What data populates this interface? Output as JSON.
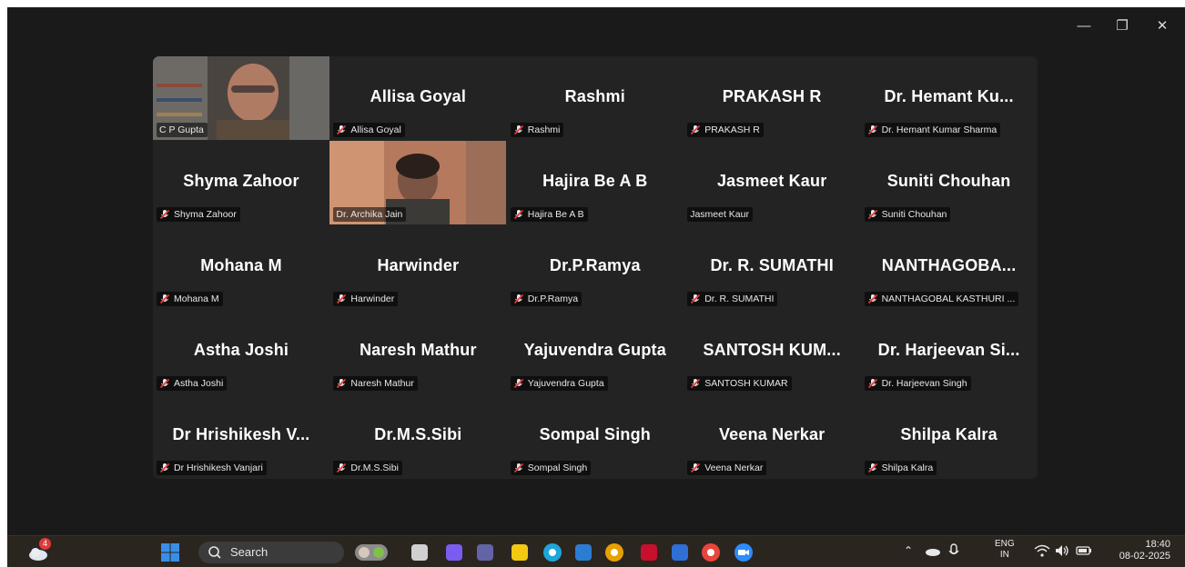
{
  "window": {
    "minimize": "—",
    "restore": "❐",
    "close": "✕"
  },
  "tiles": [
    {
      "label": "C P Gupta",
      "display": "",
      "video": true,
      "muted": false,
      "active": false,
      "row": 0,
      "col": 0
    },
    {
      "label": "Allisa Goyal",
      "display": "Allisa Goyal",
      "muted": true,
      "row": 0,
      "col": 1
    },
    {
      "label": "Rashmi",
      "display": "Rashmi",
      "muted": true,
      "row": 0,
      "col": 2
    },
    {
      "label": "PRAKASH R",
      "display": "PRAKASH R",
      "muted": true,
      "row": 0,
      "col": 3
    },
    {
      "label": "Dr. Hemant Kumar Sharma",
      "display": "Dr. Hemant Ku...",
      "muted": true,
      "row": 0,
      "col": 4
    },
    {
      "label": "Shyma Zahoor",
      "display": "Shyma Zahoor",
      "muted": true,
      "row": 1,
      "col": 0
    },
    {
      "label": "Dr. Archika Jain",
      "display": "",
      "video": true,
      "muted": false,
      "active": true,
      "row": 1,
      "col": 1
    },
    {
      "label": "Hajira Be A B",
      "display": "Hajira Be A B",
      "muted": true,
      "row": 1,
      "col": 2
    },
    {
      "label": "Jasmeet Kaur",
      "display": "Jasmeet Kaur",
      "muted": false,
      "row": 1,
      "col": 3
    },
    {
      "label": "Suniti Chouhan",
      "display": "Suniti Chouhan",
      "muted": true,
      "row": 1,
      "col": 4
    },
    {
      "label": "Mohana M",
      "display": "Mohana M",
      "muted": true,
      "row": 2,
      "col": 0
    },
    {
      "label": "Harwinder",
      "display": "Harwinder",
      "muted": true,
      "row": 2,
      "col": 1
    },
    {
      "label": "Dr.P.Ramya",
      "display": "Dr.P.Ramya",
      "muted": true,
      "row": 2,
      "col": 2
    },
    {
      "label": "Dr. R. SUMATHI",
      "display": "Dr. R. SUMATHI",
      "muted": true,
      "row": 2,
      "col": 3
    },
    {
      "label": "NANTHAGOBAL KASTHURI ...",
      "display": "NANTHAGOBA...",
      "muted": true,
      "row": 2,
      "col": 4
    },
    {
      "label": "Astha Joshi",
      "display": "Astha Joshi",
      "muted": true,
      "row": 3,
      "col": 0
    },
    {
      "label": "Naresh Mathur",
      "display": "Naresh Mathur",
      "muted": true,
      "row": 3,
      "col": 1
    },
    {
      "label": "Yajuvendra Gupta",
      "display": "Yajuvendra Gupta",
      "muted": true,
      "row": 3,
      "col": 2
    },
    {
      "label": "SANTOSH KUMAR",
      "display": "SANTOSH KUM...",
      "muted": true,
      "row": 3,
      "col": 3
    },
    {
      "label": "Dr. Harjeevan Singh",
      "display": "Dr. Harjeevan Si...",
      "muted": true,
      "row": 3,
      "col": 4
    },
    {
      "label": "Dr Hrishikesh Vanjari",
      "display": "Dr Hrishikesh V...",
      "muted": true,
      "row": 4,
      "col": 0
    },
    {
      "label": "Dr.M.S.Sibi",
      "display": "Dr.M.S.Sibi",
      "muted": true,
      "row": 4,
      "col": 1
    },
    {
      "label": "Sompal Singh",
      "display": "Sompal Singh",
      "muted": true,
      "row": 4,
      "col": 2
    },
    {
      "label": "Veena Nerkar",
      "display": "Veena Nerkar",
      "muted": true,
      "row": 4,
      "col": 3
    },
    {
      "label": "Shilpa Kalra",
      "display": "Shilpa Kalra",
      "muted": true,
      "row": 4,
      "col": 4
    }
  ],
  "taskbar": {
    "weather_badge": "4",
    "search_placeholder": "Search",
    "apps": [
      "windows-start-icon",
      "people-widget-icon",
      "task-view-icon",
      "copilot-icon",
      "teams-icon",
      "file-explorer-icon",
      "edge-icon",
      "microsoft-store-icon",
      "help-icon",
      "mcafee-icon",
      "mobile-app-icon",
      "chrome-icon",
      "zoom-icon"
    ],
    "app_colors": [
      "#3a8ee6",
      "#8b8b8b",
      "#d0d0d0",
      "#7a5cf0",
      "#6264a7",
      "#f2c811",
      "#1fa6d8",
      "#2b7cd3",
      "#e8a000",
      "#c8102e",
      "#2f6fd6",
      "#e8453c",
      "#2d8cff"
    ],
    "lang_1": "ENG",
    "lang_2": "IN",
    "time": "18:40",
    "date": "08-02-2025"
  }
}
